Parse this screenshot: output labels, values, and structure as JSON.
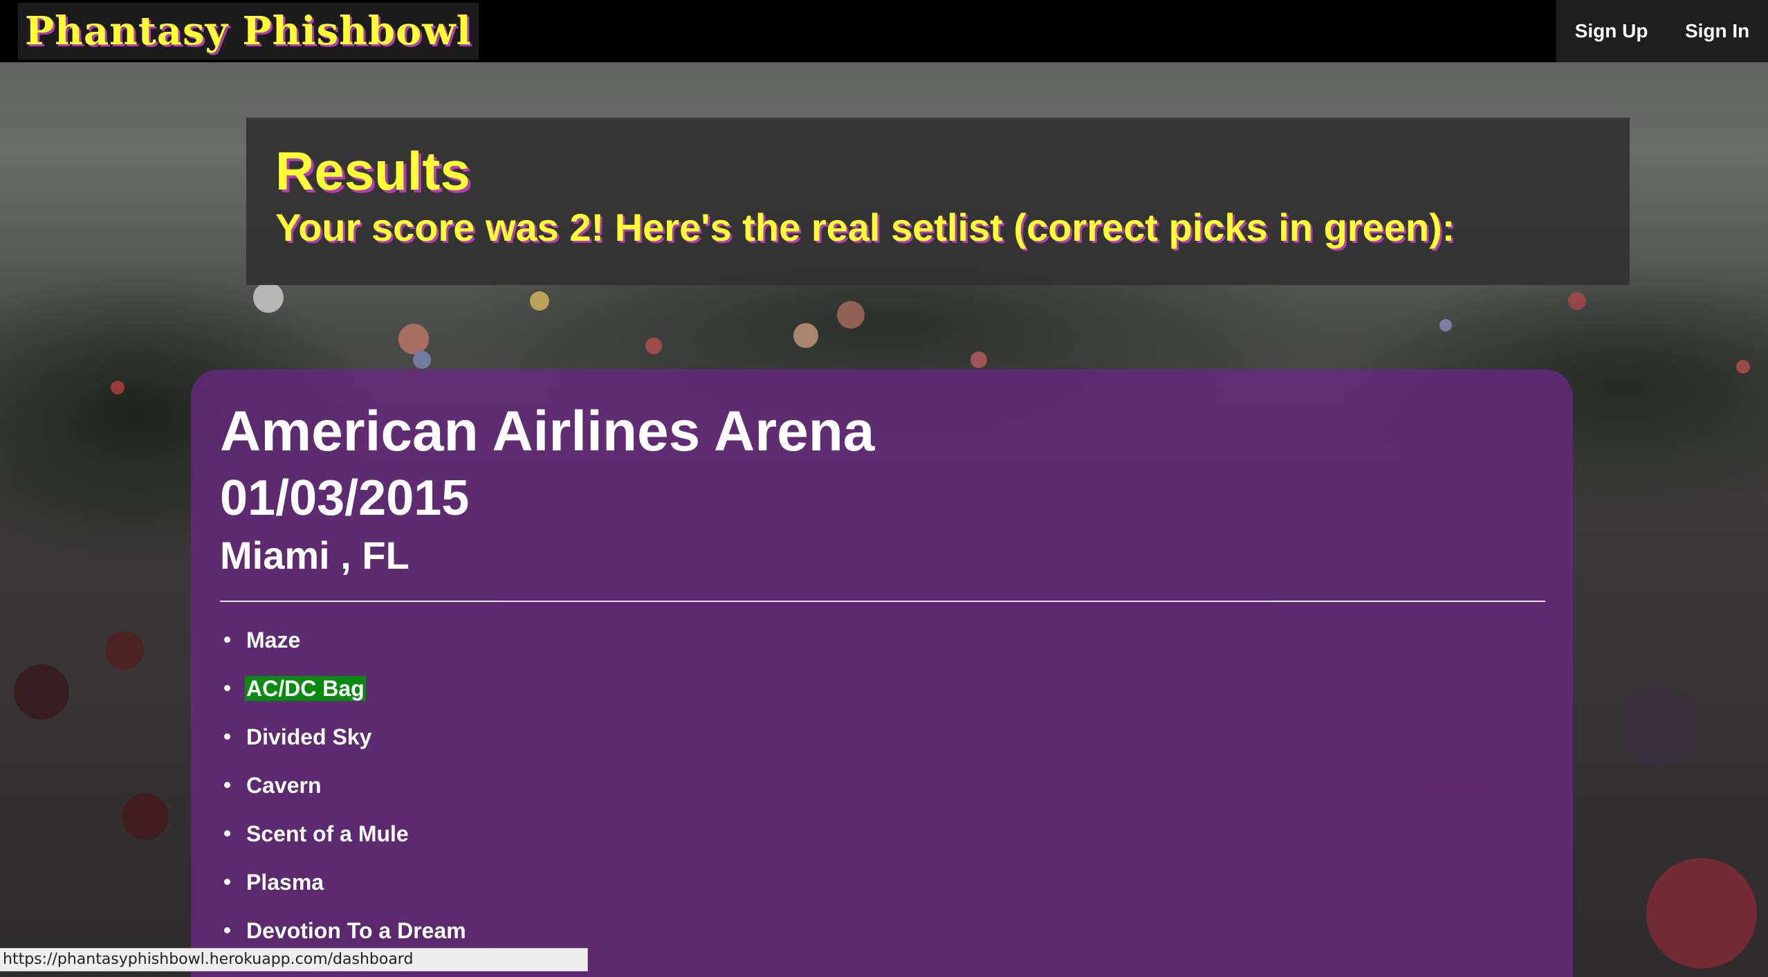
{
  "navbar": {
    "brand": "Phantasy Phishbowl",
    "links": [
      {
        "label": "Sign Up"
      },
      {
        "label": "Sign In"
      }
    ]
  },
  "results": {
    "title": "Results",
    "subtitle": "Your score was 2! Here's the real setlist (correct picks in green):",
    "score": 2
  },
  "show": {
    "venue": "American Airlines Arena",
    "date": "01/03/2015",
    "location": "Miami , FL",
    "setlist": [
      {
        "song": "Maze",
        "correct": false
      },
      {
        "song": "AC/DC Bag",
        "correct": true
      },
      {
        "song": "Divided Sky",
        "correct": false
      },
      {
        "song": "Cavern",
        "correct": false
      },
      {
        "song": "Scent of a Mule",
        "correct": false
      },
      {
        "song": "Plasma",
        "correct": false
      },
      {
        "song": "Devotion To a Dream",
        "correct": false
      }
    ]
  },
  "status_bar": {
    "url": "https://phantasyphishbowl.herokuapp.com/dashboard"
  },
  "colors": {
    "brand_yellow": "#ffff33",
    "shadow_purple": "#b43cb4",
    "card_purple": "#692882",
    "correct_green": "#0a8a12"
  }
}
